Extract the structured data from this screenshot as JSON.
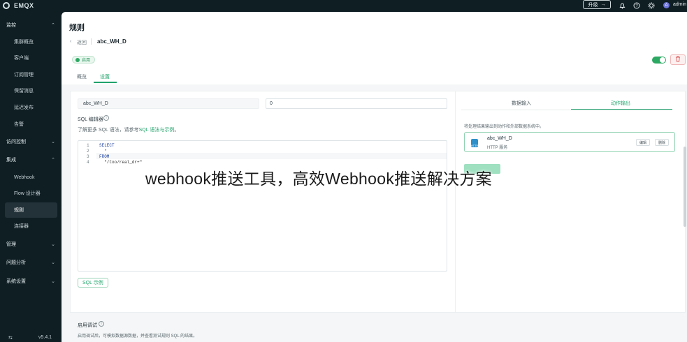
{
  "app": {
    "brand": "EMQX"
  },
  "topbar": {
    "upgrade_label": "升级",
    "upgrade_arrow": "→",
    "user": "admin",
    "avatar_letter": "A",
    "icons": [
      "bell-icon",
      "help-icon",
      "gear-icon"
    ]
  },
  "sidebar": {
    "items": [
      {
        "label": "监控",
        "chevron": "⌃"
      },
      {
        "label": "集群概览"
      },
      {
        "label": "客户端"
      },
      {
        "label": "订阅管理"
      },
      {
        "label": "保留消息"
      },
      {
        "label": "延迟发布"
      },
      {
        "label": "告警"
      },
      {
        "label": "访问控制",
        "chevron": "⌄"
      },
      {
        "label": "集成",
        "chevron": "⌃"
      },
      {
        "label": "Webhook"
      },
      {
        "label": "Flow 设计器"
      },
      {
        "label": "规则"
      },
      {
        "label": "连接器"
      },
      {
        "label": "管理",
        "chevron": "⌄"
      },
      {
        "label": "问题分析",
        "chevron": "⌄"
      },
      {
        "label": "系统设置",
        "chevron": "⌄"
      }
    ],
    "footer_left": "⇆",
    "footer_right": "v5.4.1"
  },
  "page": {
    "title": "规则",
    "back_label": "返回",
    "rule_name": "abc_WH_D",
    "status": "启用",
    "tabs": [
      "概览",
      "设置"
    ],
    "active_tab": "设置",
    "delete_icon": "🗑"
  },
  "form": {
    "name_value": "abc_WH_D",
    "number_value": "0",
    "editor_label": "SQL 编辑器",
    "hint_prefix": "了解更多 SQL 语法，请参考",
    "hint_link": "SQL 语法与示例",
    "hint_suffix": "。",
    "code_lines": [
      {
        "ln": "1",
        "text": "SELECT",
        "kind": "kw"
      },
      {
        "ln": "2",
        "text": "  *",
        "kind": "kw"
      },
      {
        "ln": "3",
        "text": "FROM",
        "kind": "kw"
      },
      {
        "ln": "4",
        "text": "  \"/too/real_dr+\"",
        "kind": "str"
      }
    ],
    "sql_example_label": "SQL 示例"
  },
  "right_panel": {
    "tabs": [
      "数据输入",
      "动作输出"
    ],
    "active_tab": "动作输出",
    "description": "将处理结果输出到动作和外部数据系统中。",
    "action": {
      "name": "abc_WH_D",
      "type": "HTTP 服务",
      "edit_label": "编辑",
      "delete_label": "删除",
      "icon_text": "HTTP"
    }
  },
  "debug": {
    "title": "启用调试",
    "description": "启用调试后，可模拟数据源数据，并查看测试规则 SQL 的结果。"
  },
  "watermark": "webhook推送工具，高效Webhook推送解决方案"
}
